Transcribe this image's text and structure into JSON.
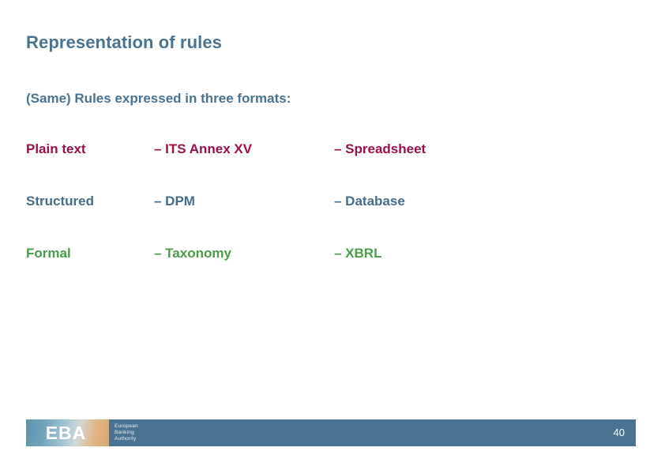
{
  "slide": {
    "title": "Representation of rules",
    "subtitle": "(Same) Rules expressed in three formats:",
    "colors": {
      "title_blue": "#4a7391",
      "row_plain": "#9b1046",
      "row_structured": "#466d8c",
      "row_formal": "#4a9c4a",
      "footer_bar": "#4a7391"
    },
    "rows": [
      {
        "level": "Plain text",
        "model": "– ITS Annex XV",
        "format": "– Spreadsheet"
      },
      {
        "level": "Structured",
        "model": "– DPM",
        "format": "– Database"
      },
      {
        "level": "Formal",
        "model": "– Taxonomy",
        "format": "– XBRL"
      }
    ]
  },
  "footer": {
    "logo": {
      "mark": "EBA",
      "line1": "European",
      "line2": "Banking",
      "line3": "Authority"
    },
    "page_number": "40"
  }
}
